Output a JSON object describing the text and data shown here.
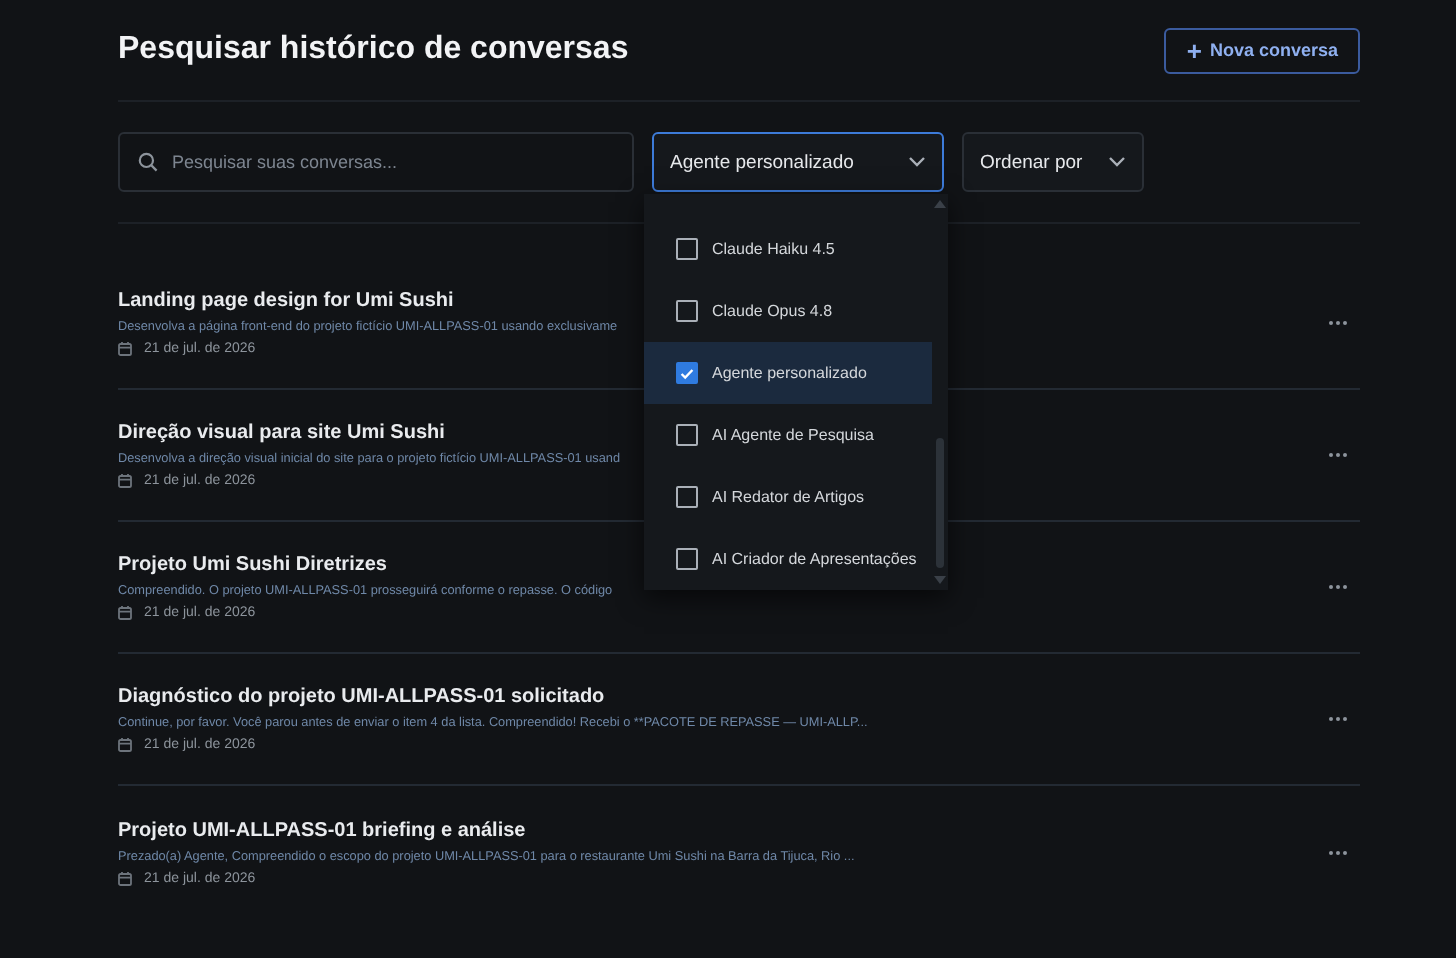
{
  "header": {
    "title": "Pesquisar histórico de conversas",
    "new_button": {
      "icon": "+",
      "label": "Nova conversa"
    }
  },
  "search": {
    "placeholder": "Pesquisar suas conversas..."
  },
  "agent_filter": {
    "value": "Agente personalizado",
    "expanded": true,
    "options": [
      {
        "label": "Claude Haiku 4.5",
        "checked": false
      },
      {
        "label": "Claude Opus 4.8",
        "checked": false
      },
      {
        "label": "Agente personalizado",
        "checked": true
      },
      {
        "label": "AI Agente de Pesquisa",
        "checked": false
      },
      {
        "label": "AI Redator de Artigos",
        "checked": false
      },
      {
        "label": "AI Criador de Apresentações",
        "checked": false
      }
    ]
  },
  "sort": {
    "label": "Ordenar por"
  },
  "conversations": [
    {
      "title": "Landing page design for Umi Sushi",
      "preview": "Desenvolva a página front-end do projeto fictício UMI-ALLPASS-01 usando exclusivame",
      "date": "21 de jul. de 2026"
    },
    {
      "title": "Direção visual para site Umi Sushi",
      "preview": "Desenvolva a direção visual inicial do site para o projeto fictício UMI-ALLPASS-01 usand",
      "date": "21 de jul. de 2026"
    },
    {
      "title": "Projeto Umi Sushi Diretrizes",
      "preview": "Compreendido. O projeto UMI-ALLPASS-01 prosseguirá conforme o repasse. O código",
      "date": "21 de jul. de 2026"
    },
    {
      "title": "Diagnóstico do projeto UMI-ALLPASS-01 solicitado",
      "preview": "Continue, por favor. Você parou antes de enviar o item 4 da lista. Compreendido! Recebi o **PACOTE DE REPASSE — UMI-ALLP...",
      "date": "21 de jul. de 2026"
    },
    {
      "title": "Projeto UMI-ALLPASS-01 briefing e análise",
      "preview": "Prezado(a) Agente, Compreendido o escopo do projeto UMI-ALLPASS-01 para o restaurante Umi Sushi na Barra da Tijuca, Rio ...",
      "date": "21 de jul. de 2026"
    }
  ]
}
